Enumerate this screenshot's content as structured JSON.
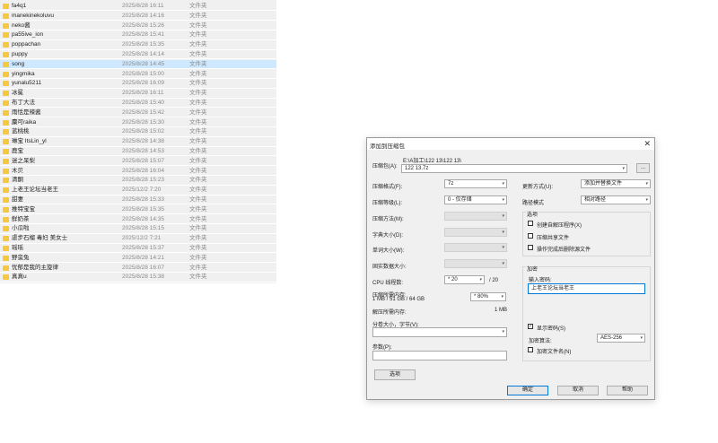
{
  "file_list": {
    "rows": [
      {
        "name": "fa4q1",
        "date": "2025/8/28 16:11",
        "type": "文件夹"
      },
      {
        "name": "manekinekoluvu",
        "date": "2025/8/28 14:16",
        "type": "文件夹"
      },
      {
        "name": "neko酱",
        "date": "2025/8/28 15:26",
        "type": "文件夹"
      },
      {
        "name": "pa55ive_ion",
        "date": "2025/8/28 15:41",
        "type": "文件夹"
      },
      {
        "name": "poppachan",
        "date": "2025/8/28 15:35",
        "type": "文件夹"
      },
      {
        "name": "puppy",
        "date": "2025/8/28 14:14",
        "type": "文件夹"
      },
      {
        "name": "song",
        "date": "2025/8/28 14:45",
        "type": "文件夹"
      },
      {
        "name": "yingmika",
        "date": "2025/8/28 15:00",
        "type": "文件夹"
      },
      {
        "name": "yunalu5211",
        "date": "2025/8/28 16:09",
        "type": "文件夹"
      },
      {
        "name": "冰冕",
        "date": "2025/8/28 16:11",
        "type": "文件夹"
      },
      {
        "name": "布丁大法",
        "date": "2025/8/28 15:40",
        "type": "文件夹"
      },
      {
        "name": "雨恬是辣酱",
        "date": "2025/8/28 15:42",
        "type": "文件夹"
      },
      {
        "name": "麋可raika",
        "date": "2025/8/28 15:30",
        "type": "文件夹"
      },
      {
        "name": "蓝桃桃",
        "date": "2025/8/28 15:02",
        "type": "文件夹"
      },
      {
        "name": "琳宝 ItsLin_yl",
        "date": "2025/8/28 14:38",
        "type": "文件夹"
      },
      {
        "name": "鹿宝",
        "date": "2025/8/28 14:53",
        "type": "文件夹"
      },
      {
        "name": "迷之呆梨",
        "date": "2025/8/28 15:07",
        "type": "文件夹"
      },
      {
        "name": "木贝",
        "date": "2025/8/28 16:04",
        "type": "文件夹"
      },
      {
        "name": "清酮",
        "date": "2025/8/28 15:23",
        "type": "文件夹"
      },
      {
        "name": "上老王论坛当老王",
        "date": "2025/12/2 7:20",
        "type": "文件夹"
      },
      {
        "name": "甜妻",
        "date": "2025/8/28 15:33",
        "type": "文件夹"
      },
      {
        "name": "推特宝宝",
        "date": "2025/8/28 15:35",
        "type": "文件夹"
      },
      {
        "name": "鲜奶茶",
        "date": "2025/8/28 14:35",
        "type": "文件夹"
      },
      {
        "name": "小瓜啦",
        "date": "2025/8/28 15:15",
        "type": "文件夹"
      },
      {
        "name": "虐步石榴 毒妇 美女士",
        "date": "2025/12/2 7:21",
        "type": "文件夹"
      },
      {
        "name": "瑶瑶",
        "date": "2025/8/28 15:37",
        "type": "文件夹"
      },
      {
        "name": "野蛮兔",
        "date": "2025/8/28 14:21",
        "type": "文件夹"
      },
      {
        "name": "忧郁是我的主旋律",
        "date": "2025/8/28 16:07",
        "type": "文件夹"
      },
      {
        "name": "真真u",
        "date": "2025/8/28 15:38",
        "type": "文件夹"
      }
    ],
    "selected_index": 6
  },
  "dialog": {
    "title": "添加到压缩包",
    "close_glyph": "✕",
    "archive_label": "压缩包(A):",
    "archive_path": "E:\\A加工\\122 13\\122 13\\",
    "archive_name": "122 13.7z",
    "browse_label": "...",
    "format_label": "压缩格式(F):",
    "format_value": "7z",
    "level_label": "压缩等级(L):",
    "level_value": "0 - 仅存储",
    "method_label": "压缩方法(M):",
    "dict_label": "字典大小(D):",
    "word_label": "单词大小(W):",
    "solid_label": "固实数据大小:",
    "cpu_label": "CPU 线程数:",
    "cpu_value": "* 20",
    "cpu_total": "/ 20",
    "mem_label": "压缩所需内存:",
    "mem_detail": "1 MB / 51 GB / 64 GB",
    "mem_value": "* 80%",
    "decomp_label": "解压所需内存:",
    "decomp_value": "1 MB",
    "split_label": "分卷大小，字节(V):",
    "params_label": "参数(P):",
    "options_button": "选项",
    "update_label": "更新方式(U):",
    "update_value": "添加并替换文件",
    "path_label": "路径模式",
    "path_value": "相对路径",
    "options_group": "选项",
    "opt_sfx": "创建自解压程序(X)",
    "opt_shared": "压缩共享文件",
    "opt_delete": "操作完成后删除源文件",
    "encrypt_group": "加密",
    "password_label": "输入密码:",
    "password_value": "上老王论坛当老王",
    "show_password": "显示密码(S)",
    "show_password_checked": true,
    "check_glyph": "✓",
    "encrypt_method_label": "加密算法:",
    "encrypt_method_value": "AES-256",
    "encrypt_names": "加密文件名(N)",
    "ok_button": "确定",
    "cancel_button": "取消",
    "help_button": "帮助",
    "dropdown_glyph": "▾"
  }
}
